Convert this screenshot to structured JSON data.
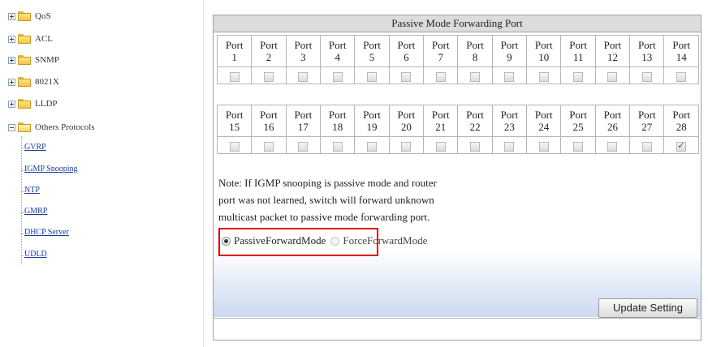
{
  "sidebar": {
    "items": [
      {
        "label": "QoS",
        "state": "collapsed"
      },
      {
        "label": "ACL",
        "state": "collapsed"
      },
      {
        "label": "SNMP",
        "state": "collapsed"
      },
      {
        "label": "8021X",
        "state": "collapsed"
      },
      {
        "label": "LLDP",
        "state": "collapsed"
      },
      {
        "label": "Others Protocols",
        "state": "expanded"
      }
    ],
    "subitems": [
      "GVRP",
      "IGMP Snooping",
      "NTP",
      "GMRP",
      "DHCP Server",
      "UDLD"
    ]
  },
  "panel": {
    "title": "Passive Mode Forwarding Port",
    "port_prefix": "Port",
    "row1_ports": [
      "1",
      "2",
      "3",
      "4",
      "5",
      "6",
      "7",
      "8",
      "9",
      "10",
      "11",
      "12",
      "13",
      "14"
    ],
    "row2_ports": [
      "15",
      "16",
      "17",
      "18",
      "19",
      "20",
      "21",
      "22",
      "23",
      "24",
      "25",
      "26",
      "27",
      "28"
    ],
    "checked_ports": [
      "28"
    ],
    "note_lines": [
      "Note: If IGMP snooping is passive mode and router",
      "port was not learned, switch will forward unknown",
      "multicast packet to passive mode forwarding port."
    ],
    "mode_options": [
      "PassiveForwardMode",
      "ForceForwardMode"
    ],
    "selected_mode": "PassiveForwardMode",
    "update_button": "Update Setting"
  },
  "colors": {
    "highlight_box": "#e00000",
    "title_bar": "#dcdcdc",
    "link": "#1a3c9c"
  }
}
